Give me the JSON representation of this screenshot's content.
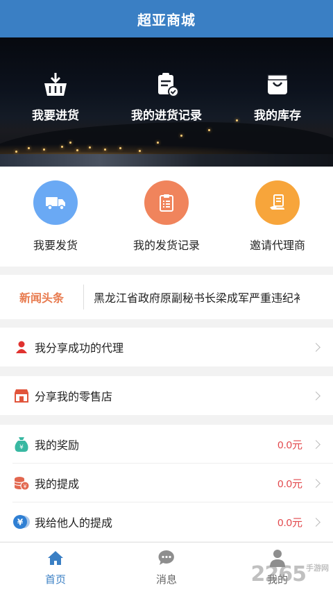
{
  "title": "超亚商城",
  "hero_items": [
    {
      "label": "我要进货",
      "icon": "basket-icon"
    },
    {
      "label": "我的进货记录",
      "icon": "clipboard-check-icon"
    },
    {
      "label": "我的库存",
      "icon": "bag-icon"
    }
  ],
  "actions": [
    {
      "label": "我要发货",
      "icon": "truck-icon",
      "color": "#6aa9f4"
    },
    {
      "label": "我的发货记录",
      "icon": "list-clipboard-icon",
      "color": "#f0845c"
    },
    {
      "label": "邀请代理商",
      "icon": "hand-document-icon",
      "color": "#f7a53b"
    }
  ],
  "news": {
    "tag": "新闻头条",
    "headline": "黑龙江省政府原副秘书长梁成军严重违纪衤"
  },
  "menu": [
    {
      "label": "我分享成功的代理",
      "icon": "user-icon",
      "value": ""
    },
    {
      "label": "分享我的零售店",
      "icon": "store-icon",
      "value": ""
    },
    {
      "label": "我的奖励",
      "icon": "money-bag-icon",
      "value": "0.0元"
    },
    {
      "label": "我的提成",
      "icon": "coins-icon",
      "value": "0.0元"
    },
    {
      "label": "我给他人的提成",
      "icon": "yen-coin-icon",
      "value": "0.0元"
    }
  ],
  "tabs": [
    {
      "label": "首页",
      "icon": "home-icon",
      "active": true
    },
    {
      "label": "消息",
      "icon": "chat-icon",
      "active": false
    },
    {
      "label": "我的",
      "icon": "person-icon",
      "active": false
    }
  ],
  "watermark": {
    "text": "2265",
    "sub": "手游网"
  },
  "colors": {
    "primary": "#3a7fc4",
    "accent": "#e87b4f",
    "value_red": "#e2464a"
  }
}
